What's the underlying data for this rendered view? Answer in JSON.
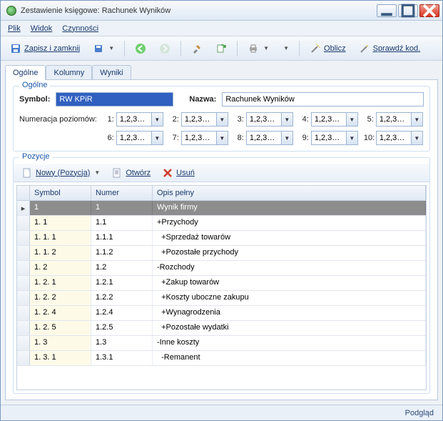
{
  "window": {
    "title": "Zestawienie księgowe: Rachunek Wyników"
  },
  "menu": {
    "items": [
      "Plik",
      "Widok",
      "Czynności"
    ]
  },
  "toolbar": {
    "save_close": "Zapisz i zamknij",
    "calc": "Oblicz",
    "check": "Sprawdź kod."
  },
  "tabs": {
    "items": [
      "Ogólne",
      "Kolumny",
      "Wyniki"
    ],
    "active": 0
  },
  "general": {
    "legend": "Ogólne",
    "symbol_label": "Symbol:",
    "symbol_value": "RW KPiR",
    "name_label": "Nazwa:",
    "name_value": "Rachunek Wyników",
    "numeration_label": "Numeracja poziomów:",
    "combo_value": "1,2,3…",
    "levels_top": [
      "1:",
      "2:",
      "3:",
      "4:",
      "5:"
    ],
    "levels_bottom": [
      "6:",
      "7:",
      "8:",
      "9:",
      "10:"
    ]
  },
  "positions": {
    "legend": "Pozycje",
    "toolbar": {
      "new": "Nowy (Pozycja)",
      "open": "Otwórz",
      "delete": "Usuń"
    },
    "columns": {
      "symbol": "Symbol",
      "numer": "Numer",
      "opis": "Opis pełny"
    },
    "rows": [
      {
        "symbol": "1",
        "numer": "1",
        "opis": "Wynik firmy",
        "selected": true,
        "marker": true
      },
      {
        "symbol": "1. 1",
        "numer": "1.1",
        "opis": "+Przychody"
      },
      {
        "symbol": "1. 1. 1",
        "numer": "1.1.1",
        "opis": "  +Sprzedaż towarów"
      },
      {
        "symbol": "1. 1. 2",
        "numer": "1.1.2",
        "opis": "  +Pozostałe przychody"
      },
      {
        "symbol": "1. 2",
        "numer": "1.2",
        "opis": "-Rozchody"
      },
      {
        "symbol": "1. 2. 1",
        "numer": "1.2.1",
        "opis": "  +Zakup towarów"
      },
      {
        "symbol": "1. 2. 2",
        "numer": "1.2.2",
        "opis": "  +Koszty uboczne zakupu"
      },
      {
        "symbol": "1. 2. 4",
        "numer": "1.2.4",
        "opis": "  +Wynagrodzenia"
      },
      {
        "symbol": "1. 2. 5",
        "numer": "1.2.5",
        "opis": "  +Pozostałe wydatki"
      },
      {
        "symbol": "1. 3",
        "numer": "1.3",
        "opis": "-Inne koszty"
      },
      {
        "symbol": "1. 3. 1",
        "numer": "1.3.1",
        "opis": "  -Remanent"
      }
    ]
  },
  "statusbar": {
    "right": "Podgląd"
  }
}
